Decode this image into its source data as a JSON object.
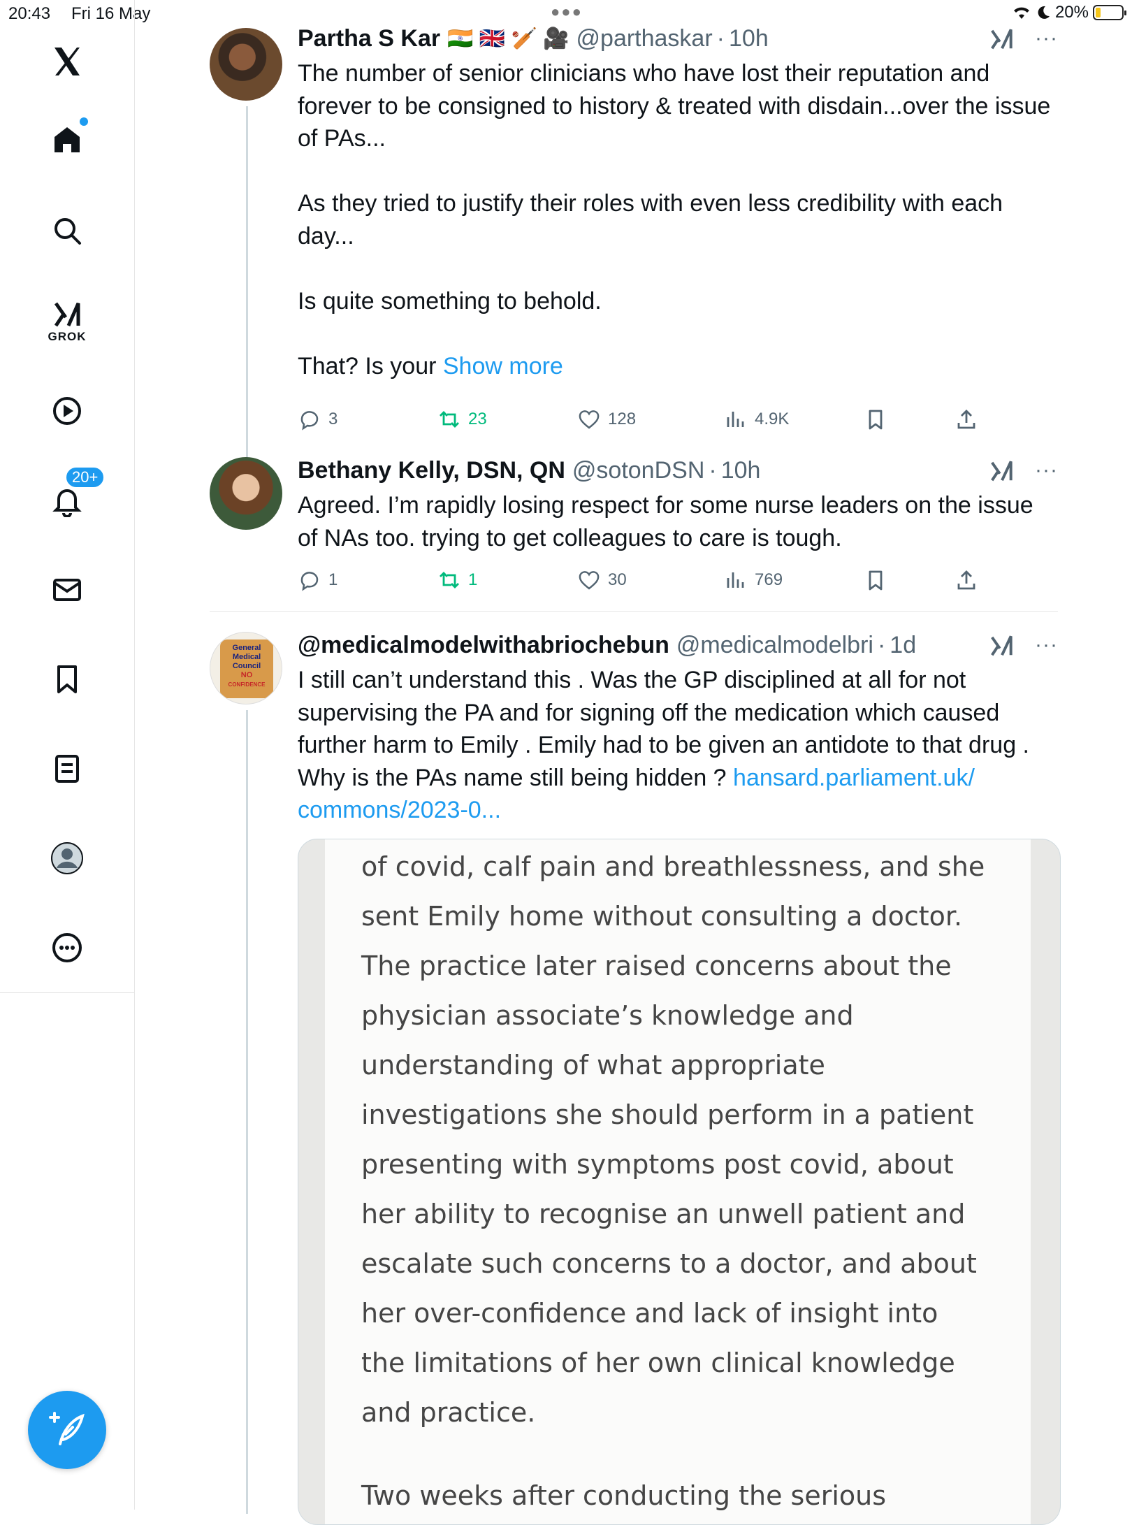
{
  "status_bar": {
    "time": "20:43",
    "date": "Fri 16 May",
    "battery": "20%",
    "battery_level": 0.2,
    "icons": [
      "wifi-icon",
      "moon-icon",
      "battery-charging-icon"
    ]
  },
  "sidebar": {
    "items": [
      {
        "name": "x-logo"
      },
      {
        "name": "home",
        "icon": "home-icon"
      },
      {
        "name": "search",
        "icon": "search-icon"
      },
      {
        "name": "grok",
        "icon": "grok-icon",
        "label": "GROK"
      },
      {
        "name": "video",
        "icon": "play-icon"
      },
      {
        "name": "notifications",
        "icon": "bell-icon",
        "badge": "20+"
      },
      {
        "name": "messages",
        "icon": "mail-icon"
      },
      {
        "name": "bookmarks",
        "icon": "bookmark-icon"
      },
      {
        "name": "lists",
        "icon": "list-icon"
      },
      {
        "name": "profile",
        "icon": "profile-icon"
      },
      {
        "name": "more",
        "icon": "more-circle-icon"
      }
    ],
    "compose_icon": "compose-icon",
    "accent_color": "#1d9bf0"
  },
  "tweets": [
    {
      "name": "Partha S Kar",
      "flags": "🇮🇳 🇬🇧 🏏 🎥",
      "handle": "@parthaskar",
      "sep": "·",
      "time": "10h",
      "text": "The number of senior clinicians who have lost their reputation and forever to be consigned to history & treated with disdain...over the issue of PAs...\n\nAs they tried to justify their roles with even less credibility with each day...\n\nIs quite something to behold.\n\nThat? Is your ",
      "show_more": "Show more",
      "replies": "3",
      "retweets": "23",
      "likes": "128",
      "views": "4.9K"
    },
    {
      "name": "Bethany Kelly, DSN, QN",
      "handle": "@sotonDSN",
      "sep": "·",
      "time": "10h",
      "text": "Agreed. I’m rapidly losing respect for some nurse leaders on the issue of NAs too. trying to get colleagues to care is tough.",
      "replies": "1",
      "retweets": "1",
      "likes": "30",
      "views": "769"
    },
    {
      "name": "@medicalmodelwithabriochebun",
      "handle": "@medicalmodelbri",
      "sep": "·",
      "time": "1d",
      "text": "I still can’t understand this . Was the GP disciplined at all for not supervising the PA and for signing off the medication which caused further harm to Emily . Emily had to be given an antidote to that drug . Why is the PAs name still being hidden ? ",
      "link": "hansard.parliament.uk/ commons/2023-0...",
      "avatar_text": [
        "General",
        "Medical",
        "Council",
        "NO",
        "CONFIDENCE"
      ],
      "media_paragraphs": [
        "of covid, calf pain and breathlessness, and she sent Emily home without consulting a doctor. The practice later raised concerns about the physician associate’s knowledge and understanding of what appropriate investigations she should perform in a patient presenting with symptoms post covid, about her ability to recognise an unwell patient and escalate such concerns to a doctor, and about her over-confidence and lack of insight into the limitations of her own clinical knowledge and practice.",
        "Two weeks after conducting the serious"
      ]
    }
  ]
}
